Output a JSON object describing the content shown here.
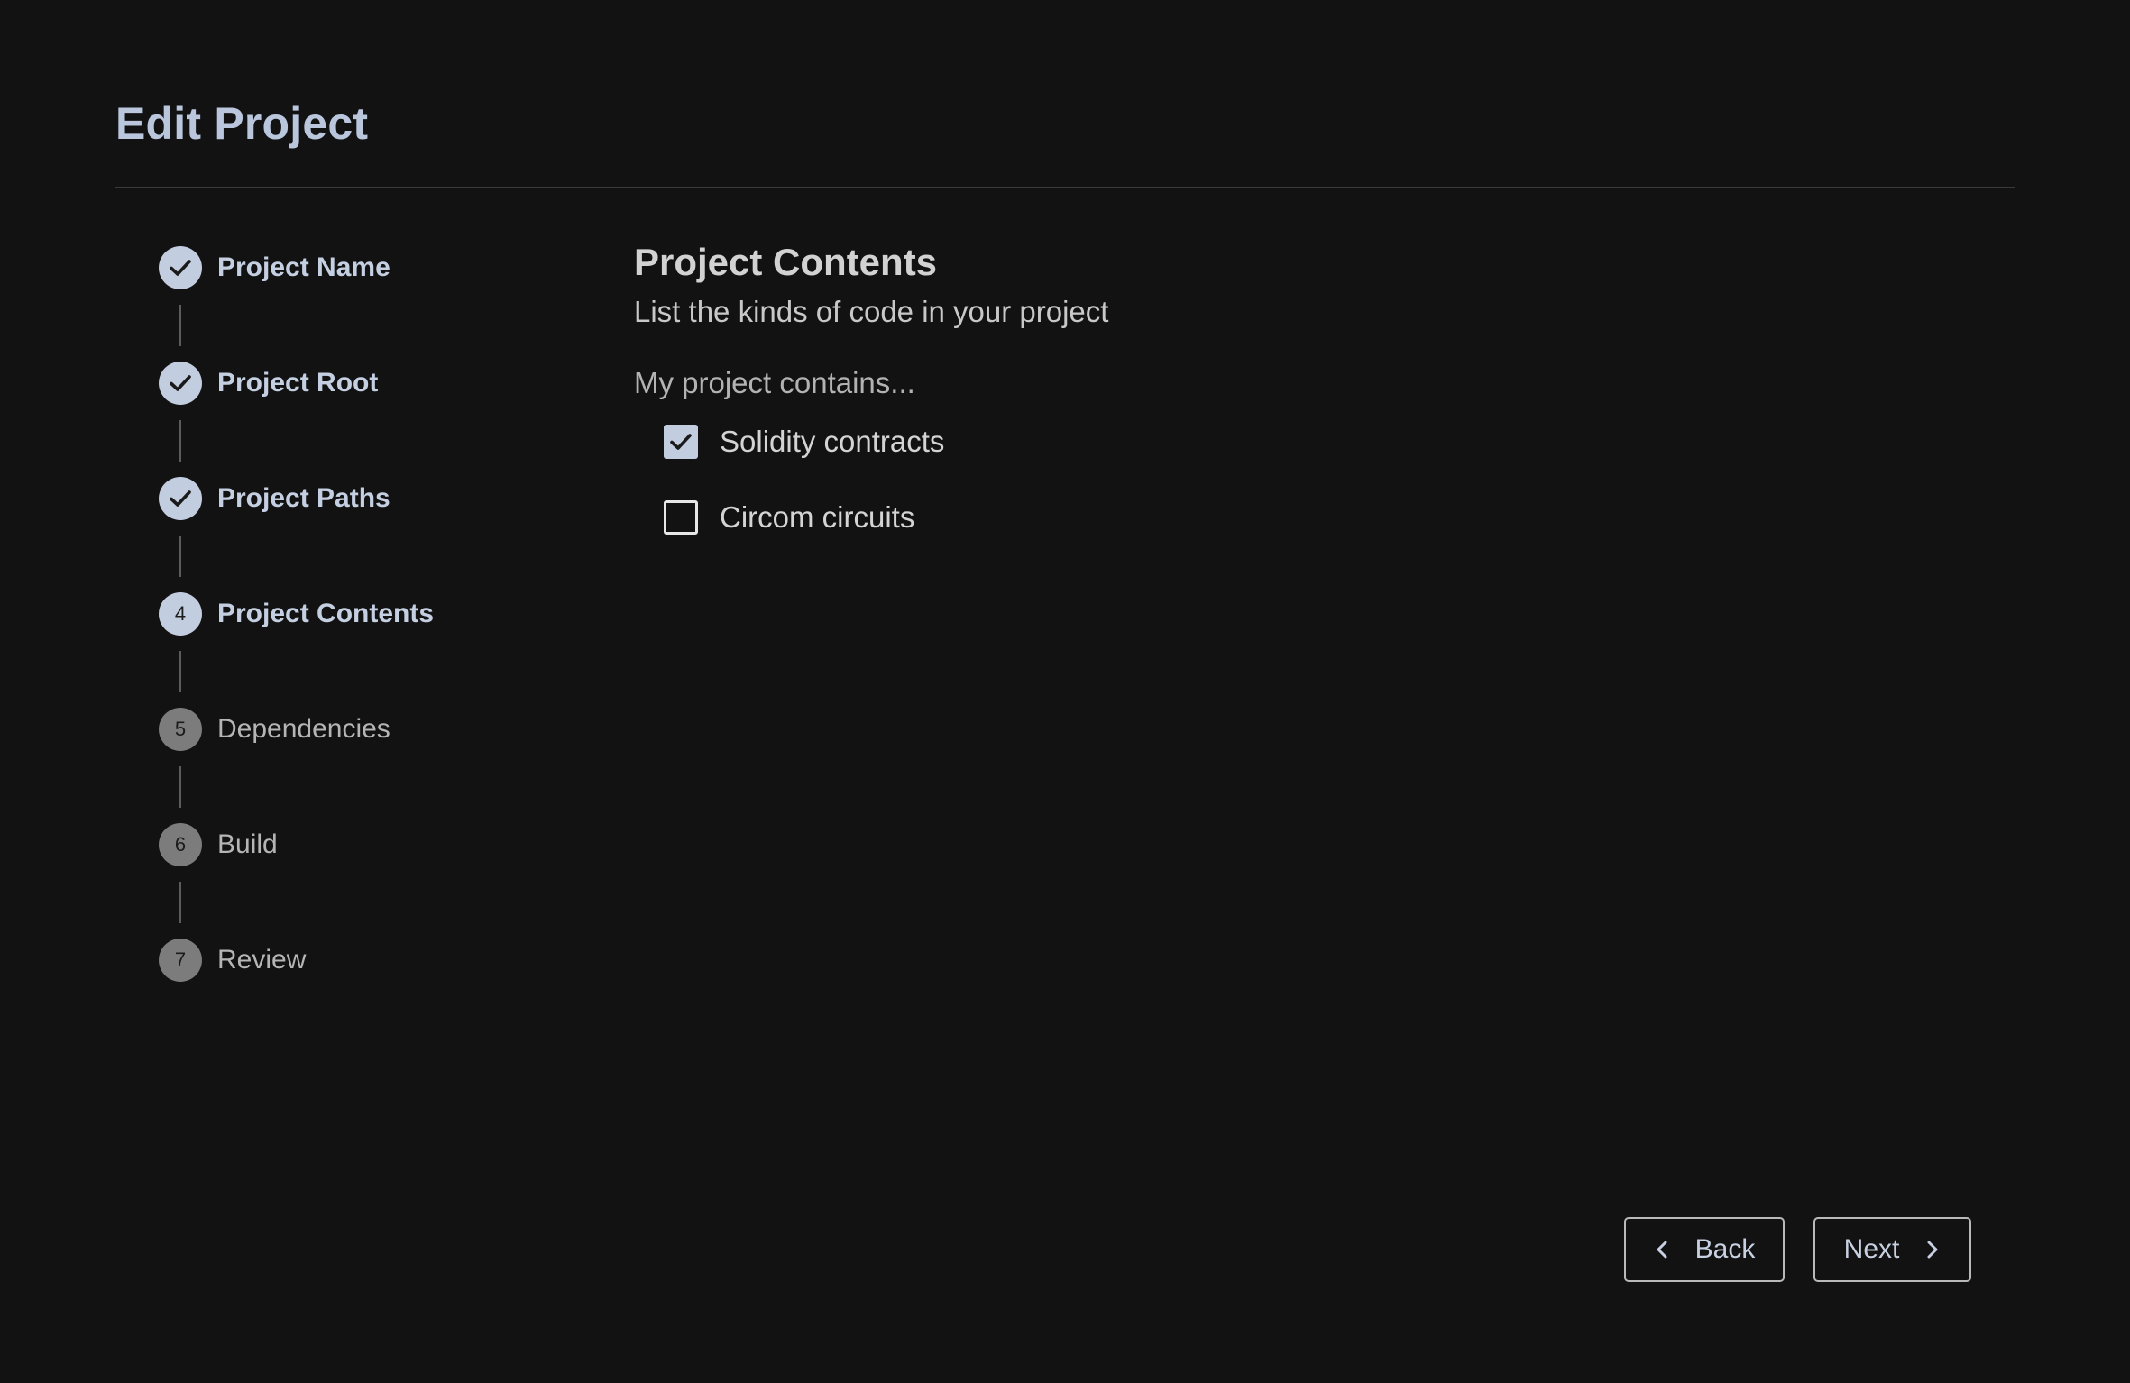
{
  "page": {
    "title": "Edit Project"
  },
  "stepper": {
    "steps": [
      {
        "label": "Project Name",
        "state": "done",
        "number": "1"
      },
      {
        "label": "Project Root",
        "state": "done",
        "number": "2"
      },
      {
        "label": "Project Paths",
        "state": "done",
        "number": "3"
      },
      {
        "label": "Project Contents",
        "state": "active",
        "number": "4"
      },
      {
        "label": "Dependencies",
        "state": "pending",
        "number": "5"
      },
      {
        "label": "Build",
        "state": "pending",
        "number": "6"
      },
      {
        "label": "Review",
        "state": "pending",
        "number": "7"
      }
    ]
  },
  "main": {
    "section_title": "Project Contents",
    "section_subtitle": "List the kinds of code in your project",
    "field_label": "My project contains...",
    "options": [
      {
        "label": "Solidity contracts",
        "checked": true
      },
      {
        "label": "Circom circuits",
        "checked": false
      }
    ]
  },
  "footer": {
    "back_label": "Back",
    "next_label": "Next"
  },
  "colors": {
    "background": "#121212",
    "accent": "#c3cde0",
    "pending": "#7c7c7c"
  }
}
